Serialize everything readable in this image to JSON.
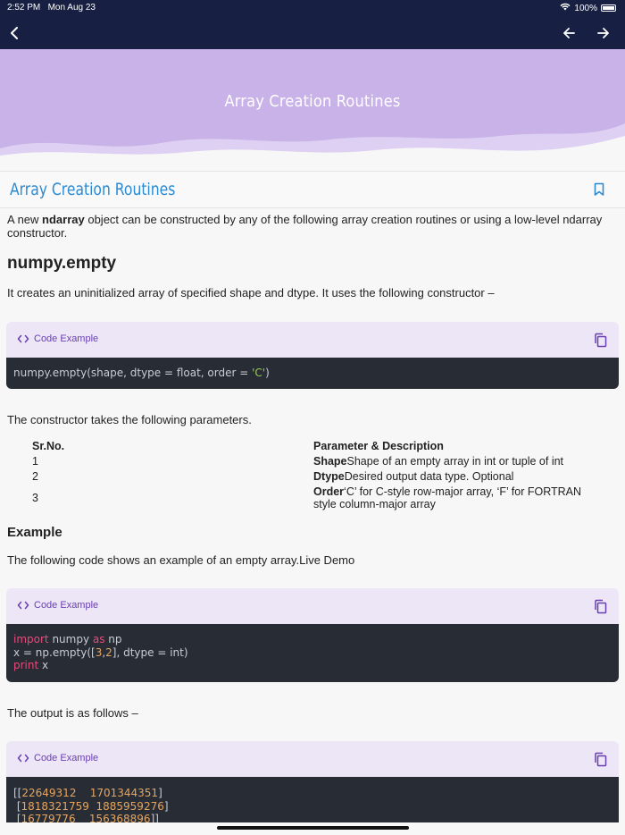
{
  "status": {
    "time": "2:52 PM",
    "date": "Mon Aug 23",
    "battery": "100%"
  },
  "hero": {
    "title": "Array Creation Routines"
  },
  "page": {
    "title": "Array Creation Routines"
  },
  "intro": {
    "pre": "A new ",
    "bold": "ndarray",
    "post": " object can be constructed by any of the following array creation routines or using a low-level ndarray constructor."
  },
  "empty_section": {
    "heading": "numpy.empty",
    "desc": "It creates an uninitialized array of specified shape and dtype. It uses the following constructor –"
  },
  "code_label": "Code Example",
  "code1": {
    "a": "numpy.empty(shape, dtype = float, order = ",
    "s": "'C'",
    "b": ")"
  },
  "params_intro": "The constructor takes the following parameters.",
  "params": {
    "col1": "Sr.No.",
    "col2": "Parameter & Description",
    "rows": [
      {
        "no": "1",
        "name": "Shape",
        "desc": "Shape of an empty array in int or tuple of int"
      },
      {
        "no": "2",
        "name": "Dtype",
        "desc": "Desired output data type. Optional"
      },
      {
        "no": "3",
        "name": "Order",
        "desc": "‘C’ for C-style row-major array, ‘F’ for FORTRAN style column-major array"
      }
    ]
  },
  "example": {
    "heading": "Example",
    "desc": "The following code shows an example of an empty array.Live Demo"
  },
  "code2": {
    "l1_kw1": "import",
    "l1_mid": " numpy ",
    "l1_kw2": "as",
    "l1_end": " np",
    "l2_a": "x = np.empty([",
    "l2_n1": "3",
    "l2_c": ",",
    "l2_n2": "2",
    "l2_b": "], dtype = int)",
    "l3_kw": "print",
    "l3_end": " x"
  },
  "output_intro": "The output is as follows –",
  "code3": {
    "r1_a": "[[",
    "r1_n1": "22649312",
    "r1_n2": "1701344351",
    "r1_b": "]",
    "r2_a": " [",
    "r2_n1": "1818321759",
    "r2_n2": "1885959276",
    "r2_b": "]",
    "r3_a": " [",
    "r3_n1": "16779776",
    "r3_n2": "156368896",
    "r3_b": "]]"
  }
}
